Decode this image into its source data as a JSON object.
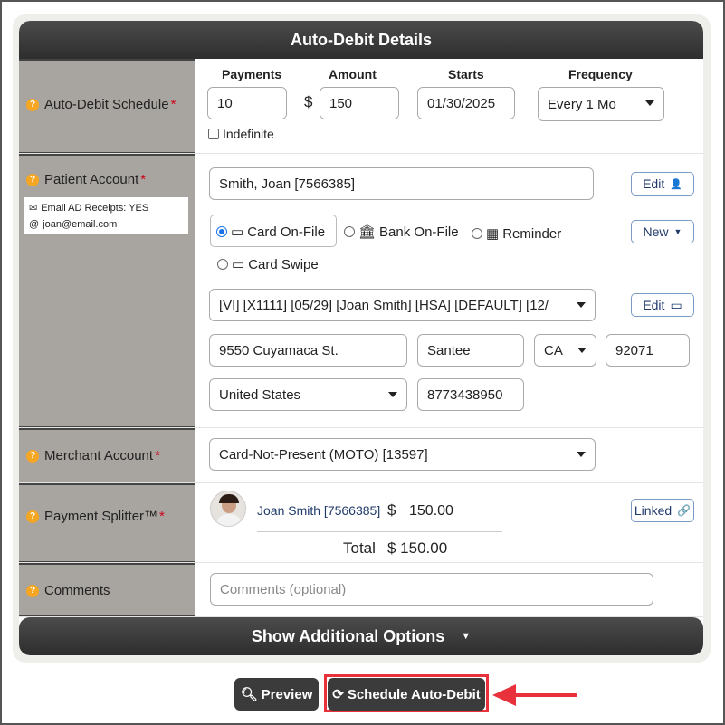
{
  "header": {
    "title": "Auto-Debit Details"
  },
  "schedule": {
    "label": "Auto-Debit Schedule",
    "req": "*",
    "cols": {
      "payments": "Payments",
      "amount": "Amount",
      "starts": "Starts",
      "frequency": "Frequency"
    },
    "payments": "10",
    "currency": "$",
    "amount": "150",
    "starts": "01/30/2025",
    "frequency": "Every 1 Mo",
    "indefinite_label": "Indefinite"
  },
  "patient": {
    "label": "Patient Account",
    "req": "*",
    "email_receipts": "Email AD Receipts: YES",
    "email": "joan@email.com",
    "account_value": "Smith, Joan [7566385]",
    "edit_label": "Edit",
    "new_label": "New",
    "methods": {
      "card_on_file": "Card On-File",
      "bank_on_file": "Bank On-File",
      "reminder": "Reminder",
      "card_swipe": "Card Swipe"
    },
    "card_select": "[VI] [X1111] [05/29] [Joan Smith] [HSA] [DEFAULT] [12/",
    "card_edit_label": "Edit",
    "address": "9550 Cuyamaca St.",
    "city": "Santee",
    "state": "CA",
    "zip": "92071",
    "country": "United States",
    "phone": "8773438950"
  },
  "merchant": {
    "label": "Merchant Account",
    "req": "*",
    "value": "Card-Not-Present (MOTO) [13597]"
  },
  "splitter": {
    "label": "Payment Splitter™",
    "req": "*",
    "patient_name": "Joan Smith [7566385]",
    "currency": "$",
    "amount": "150.00",
    "linked_label": "Linked",
    "total_label": "Total",
    "total_value": "$ 150.00"
  },
  "comments": {
    "label": "Comments",
    "placeholder": "Comments (optional)"
  },
  "footer": {
    "additional": "Show Additional Options",
    "preview": "Preview",
    "schedule": "Schedule Auto-Debit"
  },
  "colors": {
    "accent_red": "#e8313b",
    "header_dark": "#3a3a3a",
    "label_bg": "#a8a5a0",
    "help_icon": "#f5a623"
  }
}
